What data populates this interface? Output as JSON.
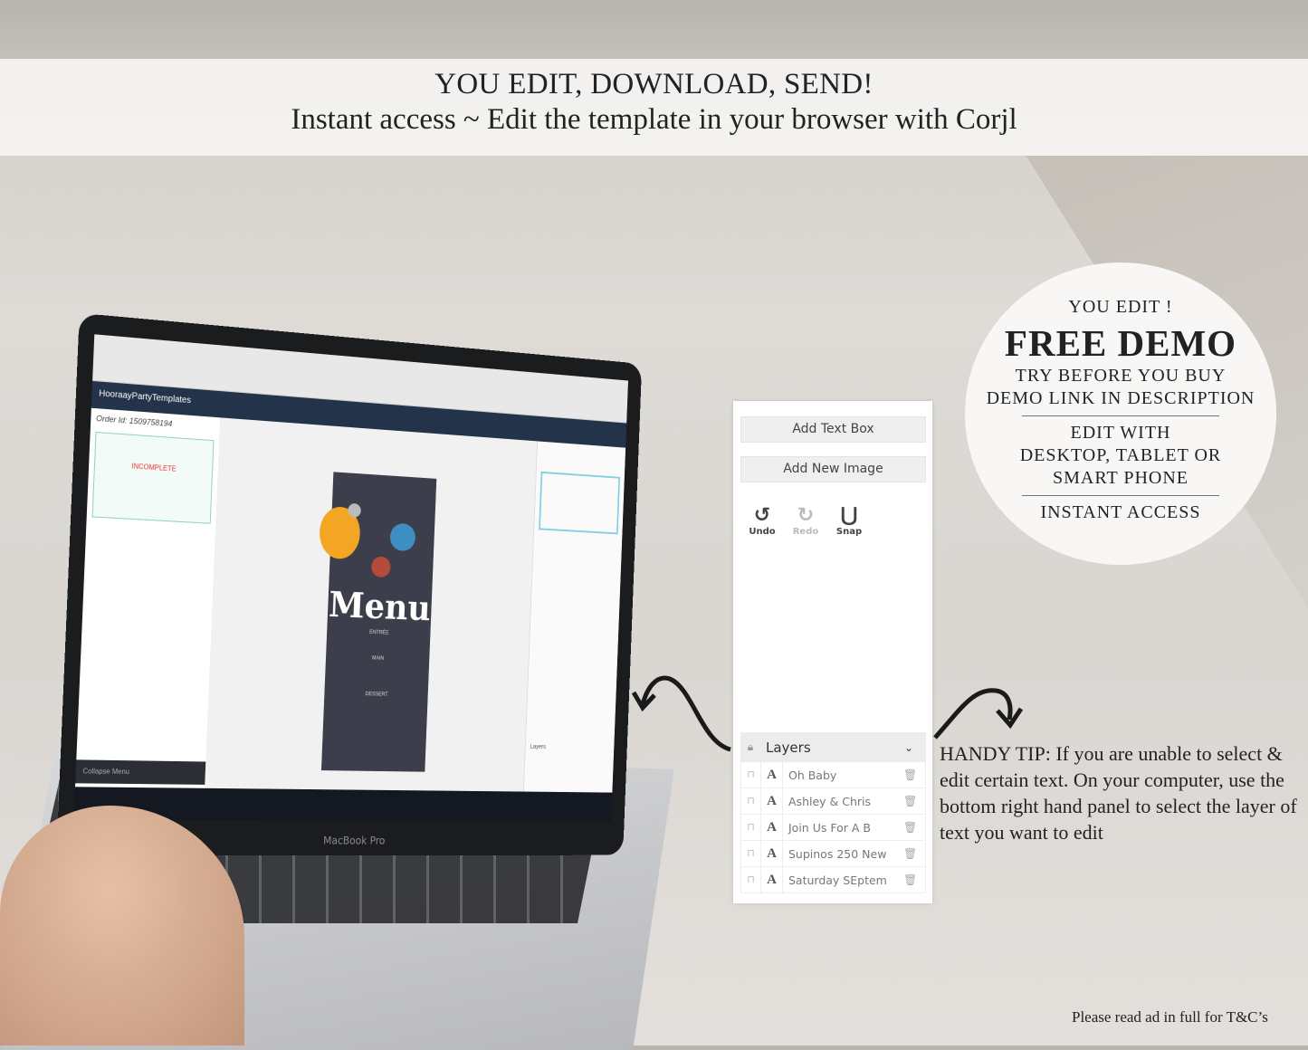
{
  "banner": {
    "line1": "YOU EDIT, DOWNLOAD, SEND!",
    "line2": "Instant access ~ Edit the template in your browser with Corjl"
  },
  "badge": {
    "line1": "YOU EDIT !",
    "title": "FREE DEMO",
    "line2": "TRY BEFORE YOU BUY",
    "line3": "DEMO LINK IN DESCRIPTION",
    "line4": "EDIT WITH",
    "line5": "DESKTOP, TABLET OR",
    "line6": "SMART PHONE",
    "line7": "INSTANT ACCESS"
  },
  "laptop": {
    "app_name": "HooraayPartyTemplates",
    "order_id": "Order Id: 1509758194",
    "status": "INCOMPLETE",
    "collapse": "Collapse Menu",
    "menu_title": "Menu",
    "sections": [
      "ENTRÉE",
      "MAIN",
      "DESSERT"
    ],
    "layers": "Layers",
    "brand": "MacBook Pro"
  },
  "panel": {
    "add_text": "Add Text Box",
    "add_image": "Add New Image",
    "undo": "Undo",
    "redo": "Redo",
    "snap": "Snap",
    "layers_title": "Layers",
    "layers": [
      "Oh Baby",
      "Ashley & Chris",
      "Join Us For A B",
      "Supinos 250 New",
      "Saturday SEptem"
    ]
  },
  "tip": "HANDY TIP: If you are unable to select & edit certain text. On your computer, use the bottom right hand panel to select the layer of text you want to edit",
  "footer": "Please read ad in full for T&C’s"
}
